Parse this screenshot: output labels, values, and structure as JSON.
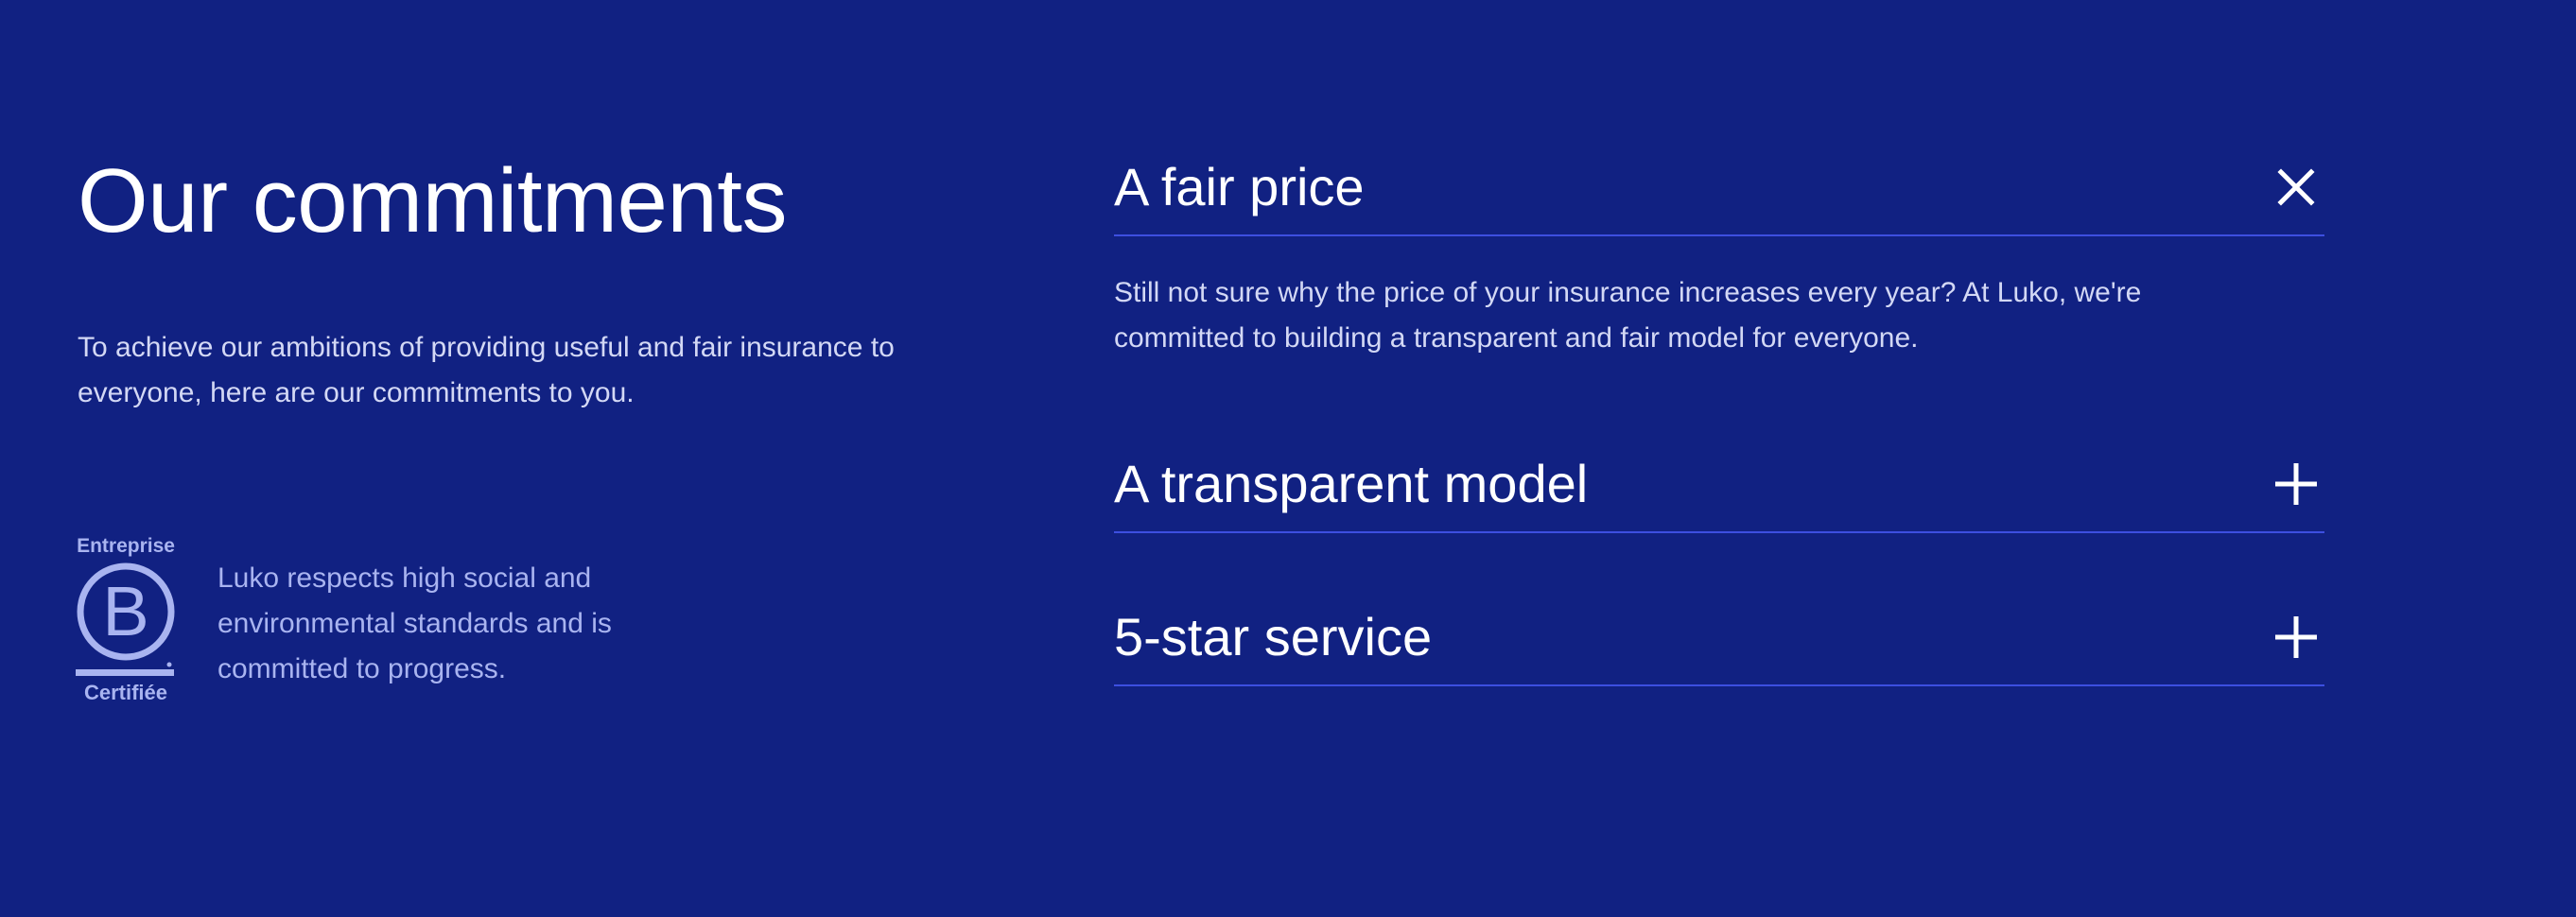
{
  "heading": "Our commitments",
  "intro": "To achieve our ambitions of providing useful and fair insurance to everyone, here are our commitments to you.",
  "bcorp": {
    "logo_top_text": "Entreprise",
    "logo_letter": "B",
    "logo_bottom_text": "Certifiée",
    "description": "Luko respects high social and environmental standards and is committed to progress."
  },
  "accordion": {
    "items": [
      {
        "title": "A fair price",
        "expanded": true,
        "icon": "close-icon",
        "body": "Still not sure why the price of your insurance increases every year? At Luko, we're committed to building a transparent and fair model for everyone."
      },
      {
        "title": "A transparent model",
        "expanded": false,
        "icon": "plus-icon"
      },
      {
        "title": "5-star service",
        "expanded": false,
        "icon": "plus-icon"
      }
    ]
  },
  "colors": {
    "background": "#112182",
    "divider": "#3d4fe0",
    "text_primary": "#ffffff",
    "text_secondary": "#d3d8f5",
    "bcorp_accent": "#a9b4f0"
  }
}
